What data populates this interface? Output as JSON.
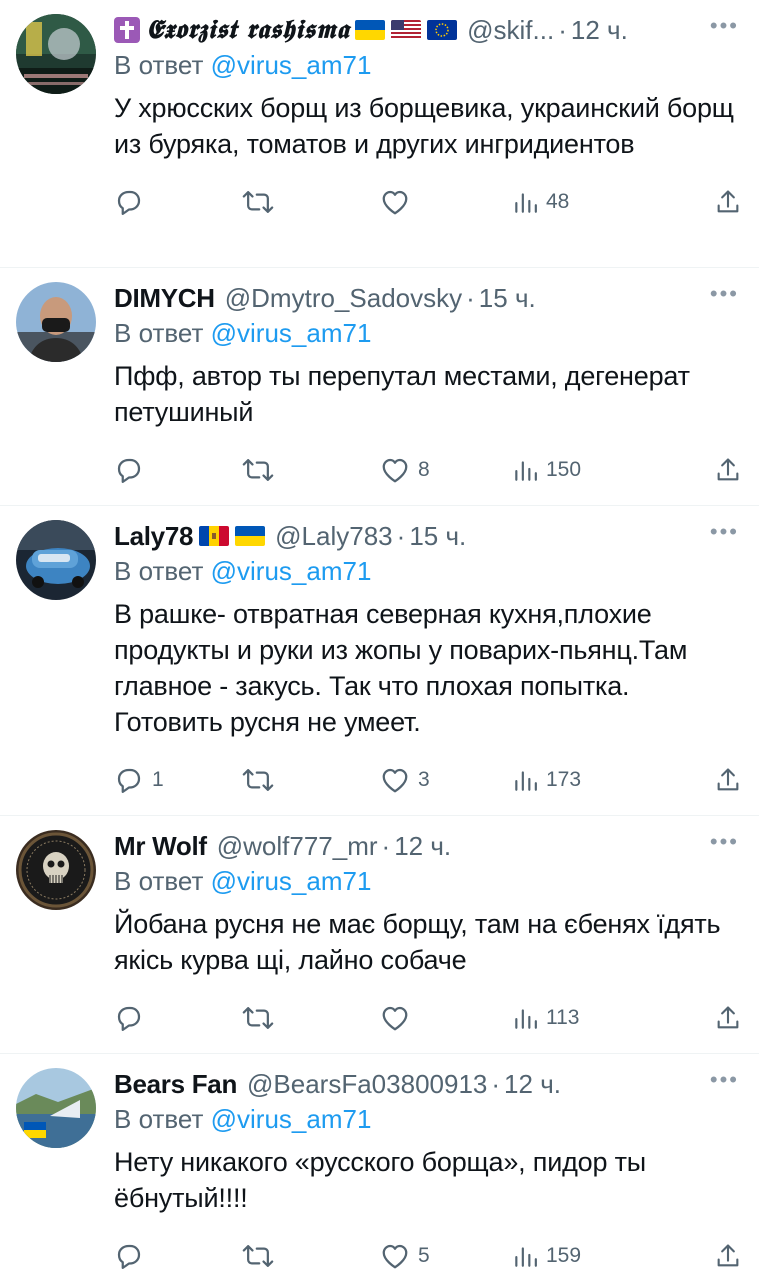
{
  "tweets": [
    {
      "name": "𝕰𝖝𝖔𝖗𝖟𝖎𝖘𝖙 𝖗𝖆𝖘𝖍𝖎𝖘𝖒𝖆",
      "handle": "@skif...",
      "sep": "·",
      "time": "12 ч.",
      "reply_prefix": "В ответ",
      "reply_mention": "@virus_am71",
      "text": "У хрюсских борщ из борщевика, украинский борщ из буряка, томатов и других ингридиентов",
      "replies": "",
      "retweets": "",
      "likes": "",
      "views": "48",
      "avatar_color": "#2a4d3e",
      "flags": [
        "ukraine-flag",
        "usa-flag",
        "eu-flag"
      ]
    },
    {
      "name": "DIMYCH",
      "handle": "@Dmytro_Sadovsky",
      "sep": "·",
      "time": "15 ч.",
      "reply_prefix": "В ответ",
      "reply_mention": "@virus_am71",
      "text": "Пфф, автор ты перепутал местами, дегенерат петушиный",
      "replies": "",
      "retweets": "",
      "likes": "8",
      "views": "150",
      "avatar_color": "#6b8fb3",
      "flags": []
    },
    {
      "name": "Laly78",
      "handle": "@Laly783",
      "sep": "·",
      "time": "15 ч.",
      "reply_prefix": "В ответ",
      "reply_mention": "@virus_am71",
      "text": "В рашке- отвратная северная кухня,плохие продукты и руки из жопы у поварих-пьянц.Там главное - закусь. Так что плохая попытка. Готовить русня не умеет.",
      "replies": "1",
      "retweets": "",
      "likes": "3",
      "views": "173",
      "avatar_color": "#3a6f9a",
      "flags": [
        "moldova-flag",
        "ukraine-flag"
      ]
    },
    {
      "name": "Mr Wolf",
      "handle": "@wolf777_mr",
      "sep": "·",
      "time": "12 ч.",
      "reply_prefix": "В ответ",
      "reply_mention": "@virus_am71",
      "text": "Йобана русня не має борщу, там на єбенях їдять якісь курва щі, лайно собаче",
      "replies": "",
      "retweets": "",
      "likes": "",
      "views": "113",
      "avatar_color": "#2b2118",
      "flags": []
    },
    {
      "name": "Bears Fan",
      "handle": "@BearsFa03800913",
      "sep": "·",
      "time": "12 ч.",
      "reply_prefix": "В ответ",
      "reply_mention": "@virus_am71",
      "text": "Нету никакого «русского борща», пидор ты ёбнутый!!!!",
      "replies": "",
      "retweets": "",
      "likes": "5",
      "views": "159",
      "avatar_color": "#7fa9c9",
      "flags": []
    }
  ],
  "colors": {
    "text": "#0f1419",
    "secondary": "#536471",
    "link": "#1d9bf0",
    "divider": "#eff3f4"
  }
}
